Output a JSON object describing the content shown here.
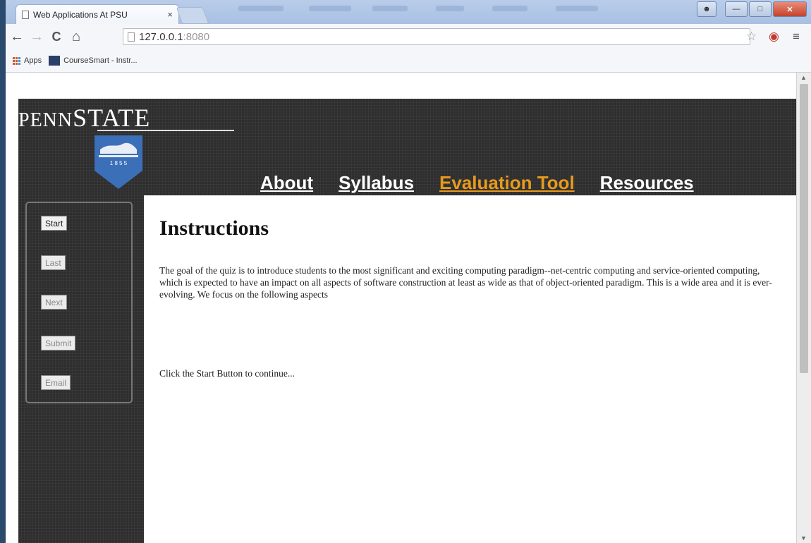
{
  "browser": {
    "tab_title": "Web Applications At PSU",
    "tab_close": "×",
    "url_host": "127.0.0.1",
    "url_port": ":8080",
    "bookmarks": [
      {
        "label": "Apps",
        "icon": "apps-grid-icon"
      },
      {
        "label": "CourseSmart - Instr...",
        "icon": "coursesmart-icon"
      }
    ]
  },
  "site": {
    "brand_penn": "PENN",
    "brand_state": "STATE",
    "shield_year": "1 8 5 5",
    "nav": [
      "About",
      "Syllabus",
      "Evaluation Tool",
      "Resources"
    ],
    "active_nav": "Evaluation Tool",
    "active_color": "#e89a1b",
    "sidebar_buttons": [
      "Start",
      "Last",
      "Next",
      "Submit",
      "Email"
    ],
    "content": {
      "heading": "Instructions",
      "intro": "The goal of the quiz is to introduce students to the most significant and exciting computing paradigm--net-centric computing and service-oriented computing, which is expected to have an impact on all aspects of software construction at least as wide as that of object-oriented paradigm. This is a wide area and it is ever-evolving. We focus on the following aspects",
      "prompt": "Click the Start Button to continue..."
    }
  }
}
